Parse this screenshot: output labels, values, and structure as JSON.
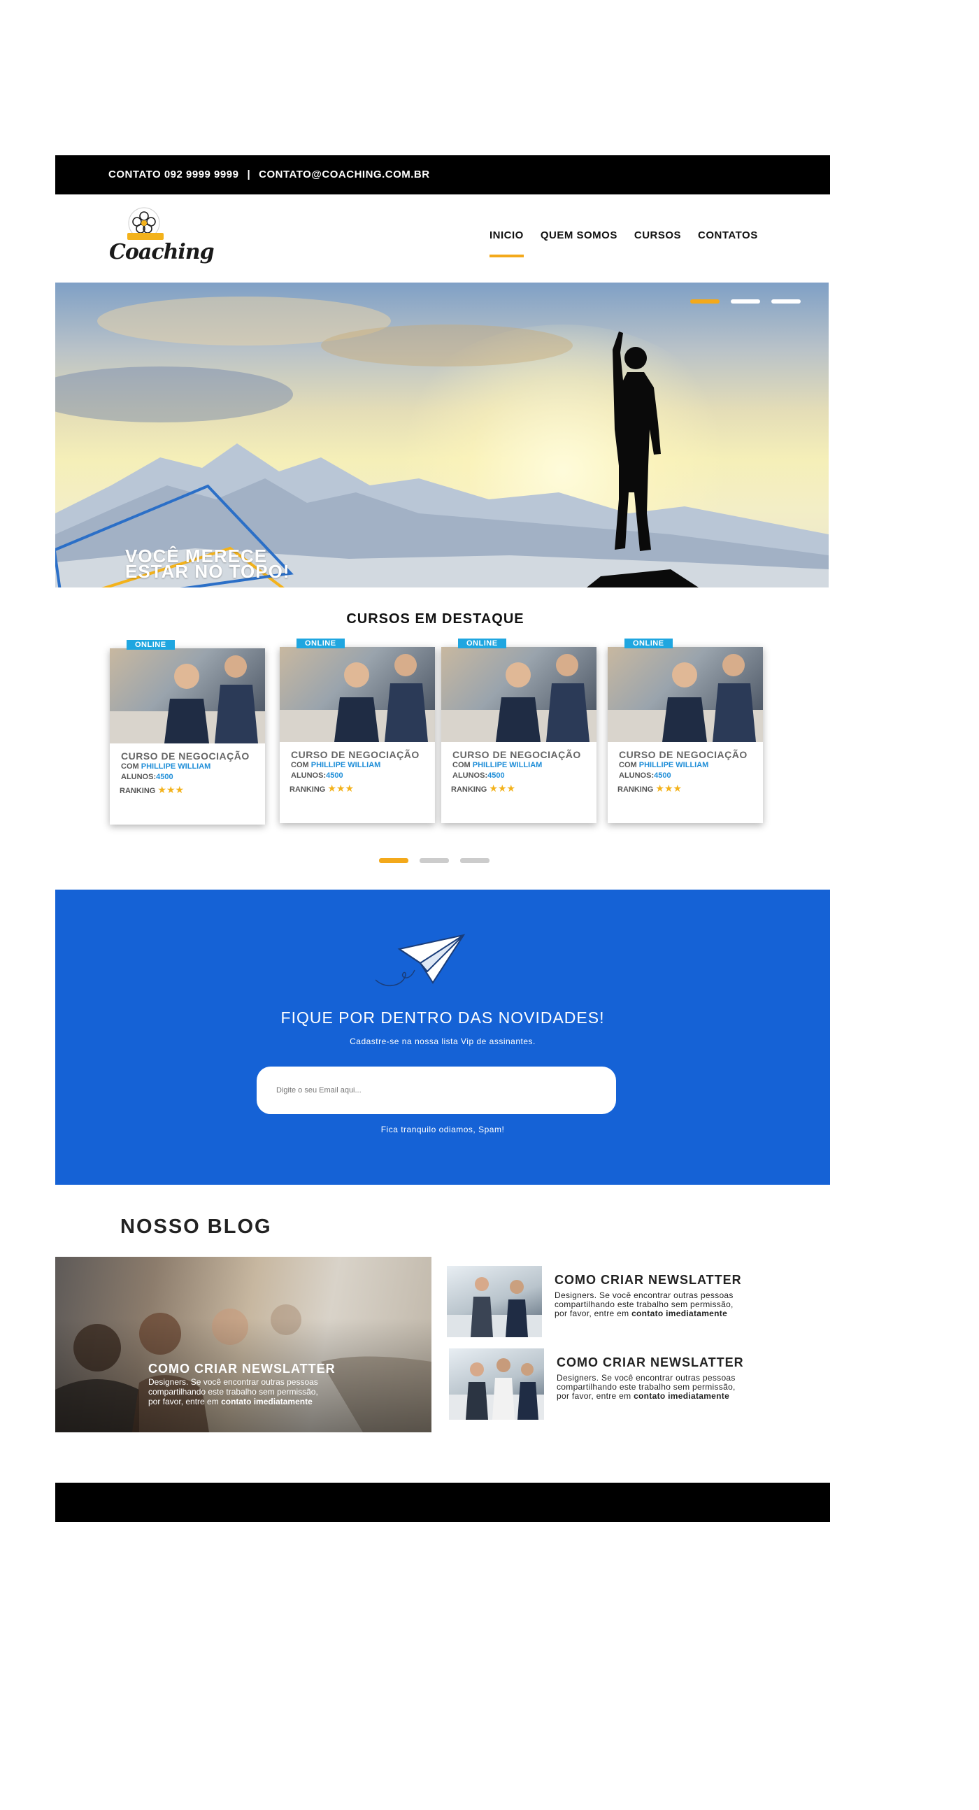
{
  "topbar": {
    "phone": "CONTATO 092 9999 9999",
    "separator": "|",
    "email": "CONTATO@COACHING.COM.BR"
  },
  "header": {
    "logo_word": "Coaching",
    "nav": [
      {
        "label": "INICIO",
        "active": true
      },
      {
        "label": "QUEM SOMOS",
        "active": false
      },
      {
        "label": "CURSOS",
        "active": false
      },
      {
        "label": "CONTATOS",
        "active": false
      }
    ]
  },
  "hero": {
    "caption_line1": "VOCÊ MERECE",
    "caption_line2": "ESTAR NO TOPO!",
    "slides": 3,
    "active_slide": 1
  },
  "courses": {
    "title": "CURSOS EM DESTAQUE",
    "items": [
      {
        "badge": "ONLINE",
        "name": "CURSO DE NEGOCIAÇÃO",
        "by_prefix": "COM",
        "teacher": "PHILLIPE WILLIAM",
        "students_label": "ALUNOS:",
        "students": "4500",
        "ranking_label": "RANKING",
        "stars": "★★★"
      },
      {
        "badge": "ONLINE",
        "name": "CURSO DE NEGOCIAÇÃO",
        "by_prefix": "COM",
        "teacher": "PHILLIPE WILLIAM",
        "students_label": "ALUNOS:",
        "students": "4500",
        "ranking_label": "RANKING",
        "stars": "★★★"
      },
      {
        "badge": "ONLINE",
        "name": "CURSO DE NEGOCIAÇÃO",
        "by_prefix": "COM",
        "teacher": "PHILLIPE WILLIAM",
        "students_label": "ALUNOS:",
        "students": "4500",
        "ranking_label": "RANKING",
        "stars": "★★★"
      },
      {
        "badge": "ONLINE",
        "name": "CURSO DE NEGOCIAÇÃO",
        "by_prefix": "COM",
        "teacher": "PHILLIPE WILLIAM",
        "students_label": "ALUNOS:",
        "students": "4500",
        "ranking_label": "RANKING",
        "stars": "★★★"
      }
    ],
    "pages": 3,
    "active_page": 1
  },
  "newsletter": {
    "title": "FIQUE POR DENTRO DAS NOVIDADES!",
    "subtitle": "Cadastre-se na nossa lista Vip de assinantes.",
    "email_placeholder": "Digite o seu Email aqui...",
    "note": "Fica tranquilo odiamos, Spam!"
  },
  "blog": {
    "title": "NOSSO BLOG",
    "main": {
      "title": "COMO CRIAR NEWSLATTER",
      "text": "Designers. Se você encontrar outras pessoas compartilhando este trabalho sem permissão, por favor, entre em",
      "bold": "contato imediatamente"
    },
    "side": [
      {
        "title": "COMO CRIAR NEWSLATTER",
        "text": "Designers. Se você encontrar outras pessoas compartilhando este trabalho sem permissão, por favor, entre em",
        "bold": "contato imediatamente"
      },
      {
        "title": "COMO CRIAR NEWSLATTER",
        "text": "Designers. Se você encontrar outras pessoas compartilhando este trabalho sem permissão, por favor, entre em",
        "bold": "contato imediatamente"
      }
    ]
  },
  "colors": {
    "accent": "#f3a91b",
    "blue": "#1562d6",
    "badge": "#1fa6e0",
    "link": "#1f8ed8"
  }
}
